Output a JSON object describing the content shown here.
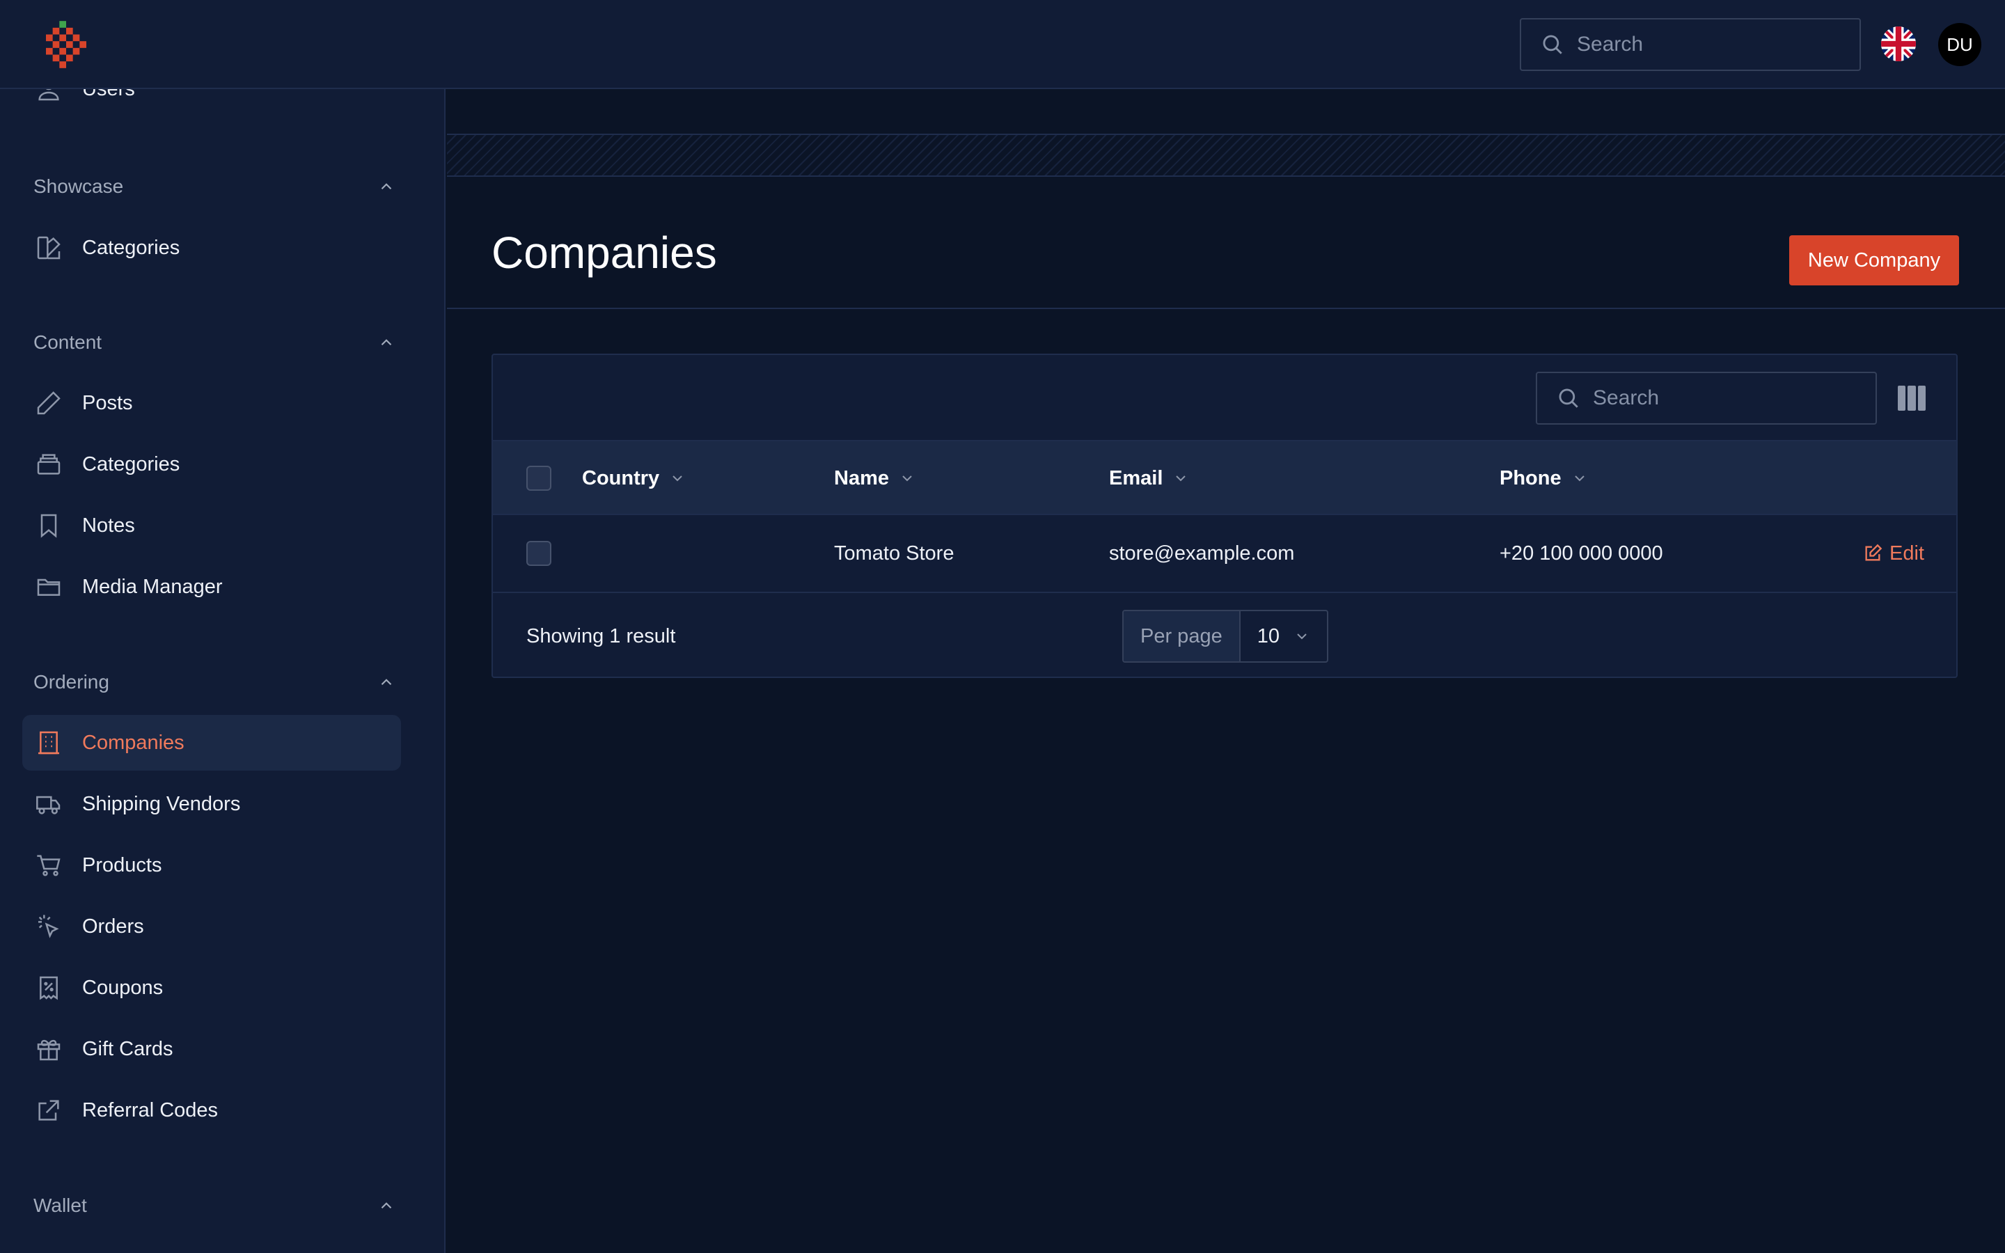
{
  "topbar": {
    "search_placeholder": "Search",
    "avatar_initials": "DU",
    "language_flag": "uk-flag-icon"
  },
  "sidebar": {
    "top_item": {
      "label": "Users",
      "icon": "user-icon"
    },
    "groups": [
      {
        "title": "Showcase",
        "items": [
          {
            "label": "Categories",
            "icon": "shapes-icon"
          }
        ]
      },
      {
        "title": "Content",
        "items": [
          {
            "label": "Posts",
            "icon": "pencil-icon"
          },
          {
            "label": "Categories",
            "icon": "archive-icon"
          },
          {
            "label": "Notes",
            "icon": "bookmark-icon"
          },
          {
            "label": "Media Manager",
            "icon": "folder-icon"
          }
        ]
      },
      {
        "title": "Ordering",
        "items": [
          {
            "label": "Companies",
            "icon": "building-icon",
            "active": true
          },
          {
            "label": "Shipping Vendors",
            "icon": "truck-icon"
          },
          {
            "label": "Products",
            "icon": "cart-icon"
          },
          {
            "label": "Orders",
            "icon": "cursor-click-icon"
          },
          {
            "label": "Coupons",
            "icon": "receipt-percent-icon"
          },
          {
            "label": "Gift Cards",
            "icon": "gift-icon"
          },
          {
            "label": "Referral Codes",
            "icon": "external-link-icon"
          }
        ]
      },
      {
        "title": "Wallet",
        "items": []
      }
    ]
  },
  "page": {
    "title": "Companies",
    "new_button": "New Company"
  },
  "table": {
    "search_placeholder": "Search",
    "columns": [
      "Country",
      "Name",
      "Email",
      "Phone"
    ],
    "rows": [
      {
        "country": "",
        "name": "Tomato Store",
        "email": "store@example.com",
        "phone": "+20 100 000 0000",
        "action": "Edit"
      }
    ],
    "footer": {
      "showing": "Showing 1 result",
      "per_page_label": "Per page",
      "per_page_value": "10"
    }
  },
  "colors": {
    "accent": "#d8442a",
    "accent_text": "#f07a5c",
    "background": "#0b1426",
    "panel": "#111c36"
  }
}
